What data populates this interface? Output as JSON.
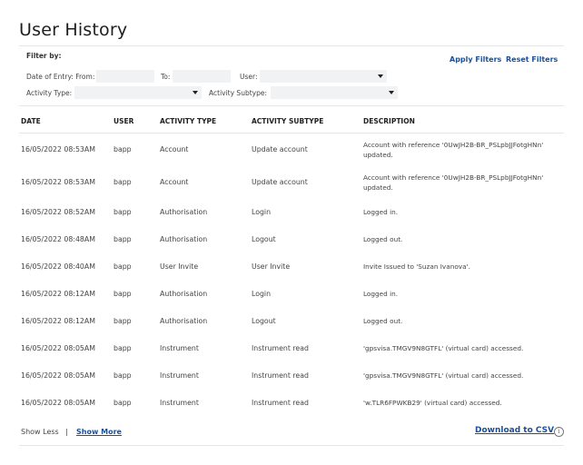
{
  "page": {
    "title": "User History"
  },
  "filters": {
    "heading": "Filter by:",
    "apply_label": "Apply Filters",
    "reset_label": "Reset Filters",
    "date_from_label": "Date of Entry: From:",
    "date_to_label": "To:",
    "user_label": "User:",
    "activity_type_label": "Activity Type:",
    "activity_subtype_label": "Activity Subtype:",
    "date_from_value": "",
    "date_to_value": "",
    "user_value": "",
    "activity_type_value": "",
    "activity_subtype_value": ""
  },
  "table": {
    "headers": [
      "DATE",
      "USER",
      "ACTIVITY TYPE",
      "ACTIVITY SUBTYPE",
      "DESCRIPTION"
    ],
    "rows": [
      {
        "date": "16/05/2022 08:53AM",
        "user": "bapp",
        "type": "Account",
        "subtype": "Update account",
        "desc": "Account with reference '0UwJH2B-BR_PSLpbJJFotgHNn' updated."
      },
      {
        "date": "16/05/2022 08:53AM",
        "user": "bapp",
        "type": "Account",
        "subtype": "Update account",
        "desc": "Account with reference '0UwJH2B-BR_PSLpbJJFotgHNn' updated."
      },
      {
        "date": "16/05/2022 08:52AM",
        "user": "bapp",
        "type": "Authorisation",
        "subtype": "Login",
        "desc": "Logged in."
      },
      {
        "date": "16/05/2022 08:48AM",
        "user": "bapp",
        "type": "Authorisation",
        "subtype": "Logout",
        "desc": "Logged out."
      },
      {
        "date": "16/05/2022 08:40AM",
        "user": "bapp",
        "type": "User Invite",
        "subtype": "User Invite",
        "desc": "Invite Issued to 'Suzan Ivanova'."
      },
      {
        "date": "16/05/2022 08:12AM",
        "user": "bapp",
        "type": "Authorisation",
        "subtype": "Login",
        "desc": "Logged in."
      },
      {
        "date": "16/05/2022 08:12AM",
        "user": "bapp",
        "type": "Authorisation",
        "subtype": "Logout",
        "desc": "Logged out."
      },
      {
        "date": "16/05/2022 08:05AM",
        "user": "bapp",
        "type": "Instrument",
        "subtype": "Instrument read",
        "desc": "'gpsvisa.TMGV9N8GTFL' (virtual card) accessed."
      },
      {
        "date": "16/05/2022 08:05AM",
        "user": "bapp",
        "type": "Instrument",
        "subtype": "Instrument read",
        "desc": "'gpsvisa.TMGV9N8GTFL' (virtual card) accessed."
      },
      {
        "date": "16/05/2022 08:05AM",
        "user": "bapp",
        "type": "Instrument",
        "subtype": "Instrument read",
        "desc": "'w.TLR6FPWKB29' (virtual card) accessed."
      }
    ]
  },
  "footer": {
    "show_less_label": "Show Less",
    "separator": "|",
    "show_more_label": "Show More",
    "download_label": "Download to CSV",
    "info_glyph": "i"
  },
  "colors": {
    "link": "#1a4f9a",
    "input_bg": "#f1f2f4",
    "divider": "#e6e6e6"
  }
}
